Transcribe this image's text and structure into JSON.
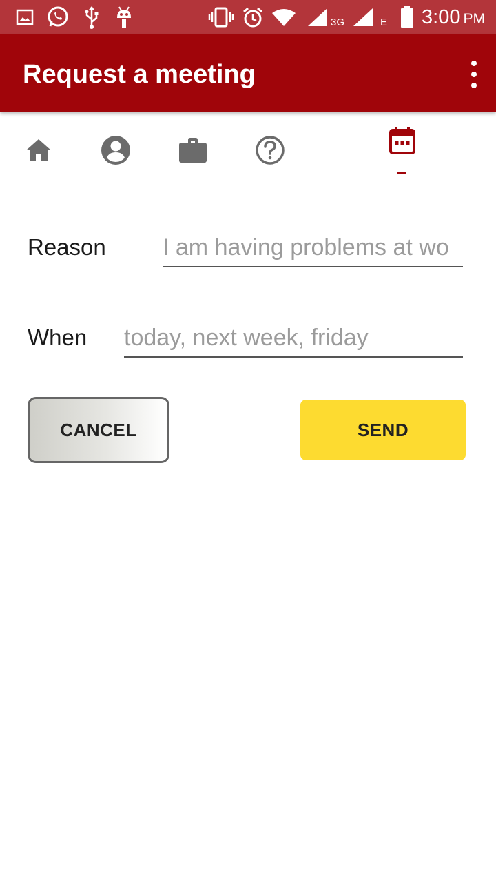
{
  "status_bar": {
    "time": "3:00",
    "ampm": "PM",
    "network_3g": "3G",
    "network_e": "E",
    "icons": [
      "image-icon",
      "whatsapp-icon",
      "usb-icon",
      "android-debug-icon",
      "vibrate-icon",
      "alarm-icon",
      "wifi-icon",
      "signal-icon",
      "signal-icon-2",
      "battery-icon"
    ]
  },
  "app_bar": {
    "title": "Request a meeting",
    "overflow_icon": "more-vert-icon"
  },
  "tabs": [
    {
      "name": "home",
      "icon": "home-icon"
    },
    {
      "name": "profile",
      "icon": "account-circle-icon"
    },
    {
      "name": "work",
      "icon": "briefcase-icon"
    },
    {
      "name": "help",
      "icon": "help-icon"
    },
    {
      "name": "meeting",
      "icon": "calendar-icon",
      "active": true
    }
  ],
  "colors": {
    "status_bar": "#b3353a",
    "app_bar": "#a0050a",
    "active_tab": "#a0050a",
    "inactive_tab": "#6b6b6b",
    "send_button": "#fddb30"
  },
  "form": {
    "reason_label": "Reason",
    "reason_placeholder": "I am having problems at wo",
    "when_label": "When",
    "when_placeholder": "today, next week, friday"
  },
  "buttons": {
    "cancel_label": "CANCEL",
    "send_label": "SEND"
  }
}
